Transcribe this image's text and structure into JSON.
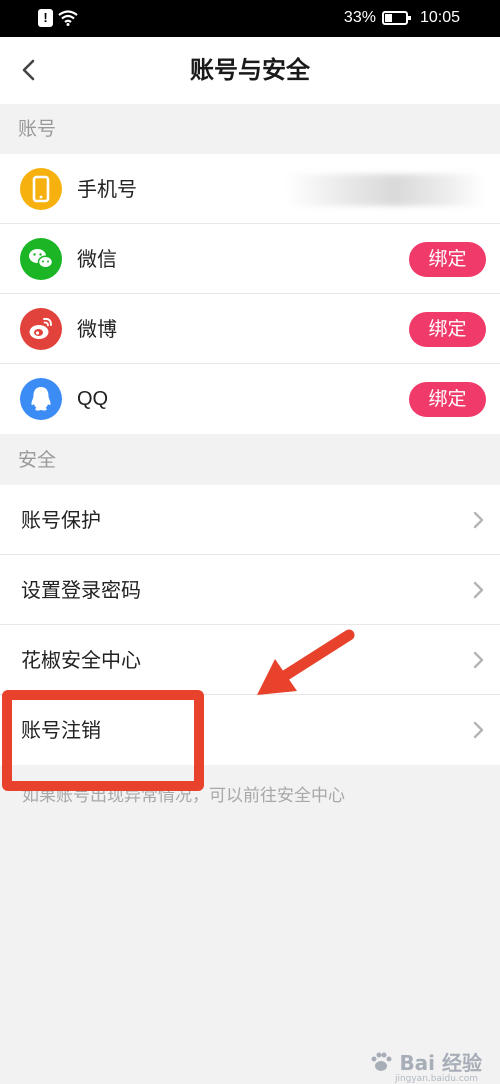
{
  "status_bar": {
    "battery_percent": "33%",
    "time": "10:05"
  },
  "nav": {
    "title": "账号与安全"
  },
  "account_section": {
    "header": "账号",
    "items": [
      {
        "label": "手机号",
        "icon": "phone-icon",
        "color": "#f6b10e"
      },
      {
        "label": "微信",
        "icon": "wechat-icon",
        "color": "#1bb526",
        "action": "绑定"
      },
      {
        "label": "微博",
        "icon": "weibo-icon",
        "color": "#e2423c",
        "action": "绑定"
      },
      {
        "label": "QQ",
        "icon": "qq-icon",
        "color": "#3b8cf5",
        "action": "绑定"
      }
    ]
  },
  "security_section": {
    "header": "安全",
    "items": [
      {
        "label": "账号保护"
      },
      {
        "label": "设置登录密码"
      },
      {
        "label": "花椒安全中心"
      },
      {
        "label": "账号注销"
      }
    ],
    "footnote": "如果账号出现异常情况，可以前往安全中心"
  },
  "watermark": {
    "brand": "Bai 经验",
    "sub": "jingyan.baidu.com"
  },
  "colors": {
    "accent": "#f03a6a",
    "annotation": "#e8412c"
  }
}
